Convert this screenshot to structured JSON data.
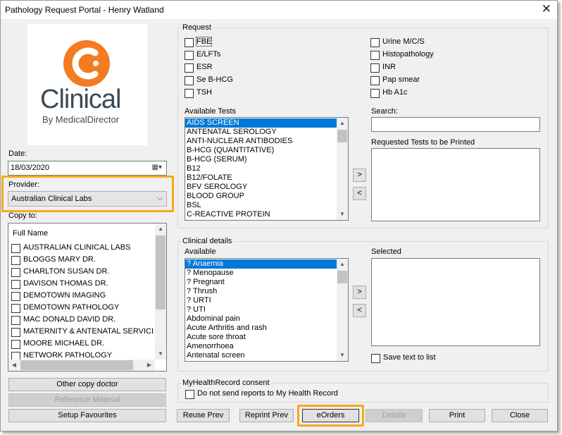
{
  "window": {
    "title": "Pathology Request Portal - Henry Watland"
  },
  "logo": {
    "brand": "Clinical",
    "tagline": "By MedicalDirector",
    "accent": "#f47b20"
  },
  "date": {
    "label": "Date:",
    "value": "18/03/2020"
  },
  "provider": {
    "label": "Provider:",
    "value": "Australian Clinical Labs"
  },
  "copy_to": {
    "label": "Copy to:",
    "header": "Full Name",
    "items": [
      "AUSTRALIAN CLINICAL LABS",
      "BLOGGS MARY DR.",
      "CHARLTON SUSAN DR.",
      "DAVISON THOMAS DR.",
      "DEMOTOWN IMAGING",
      "DEMOTOWN PATHOLOGY",
      "MAC DONALD DAVID DR.",
      "MATERNITY & ANTENATAL SERVICI",
      "MOORE MICHAEL DR.",
      "NETWORK PATHOLOGY"
    ]
  },
  "left_buttons": {
    "other_copy_doctor": "Other copy doctor",
    "reference_material": "Reference Material",
    "setup_favourites": "Setup Favourites"
  },
  "request": {
    "title": "Request",
    "left": [
      "FBE",
      "E/LFTs",
      "ESR",
      "Se B-HCG",
      "TSH"
    ],
    "right": [
      "Urine M/C/S",
      "Histopathology",
      "INR",
      "Pap smear",
      "Hb A1c"
    ]
  },
  "available_tests": {
    "label": "Available Tests",
    "items": [
      "AIDS SCREEN",
      "ANTENATAL SEROLOGY",
      "ANTI-NUCLEAR ANTIBODIES",
      "B-HCG (QUANTITATIVE)",
      "B-HCG (SERUM)",
      "B12",
      "B12/FOLATE",
      "BFV SEROLOGY",
      "BLOOD GROUP",
      "BSL",
      "C-REACTIVE PROTEIN"
    ]
  },
  "search": {
    "label": "Search:",
    "value": ""
  },
  "requested_tests": {
    "label": "Requested Tests to be Printed"
  },
  "move": {
    "right": ">",
    "left": "<"
  },
  "clinical": {
    "title": "Clinical details",
    "available_label": "Available",
    "selected_label": "Selected",
    "items": [
      "? Anaemia",
      "? Menopause",
      "? Pregnant",
      "? Thrush",
      "? URTI",
      "? UTI",
      "Abdominal pain",
      "Acute Arthritis and rash",
      "Acute sore throat",
      "Amenorrhoea",
      "Antenatal screen"
    ],
    "save_text": "Save text to list"
  },
  "mhr": {
    "title": "MyHealthRecord consent",
    "checkbox": "Do not send reports to My Health Record"
  },
  "bottom_buttons": {
    "reuse_prev": "Reuse Prev",
    "reprint_prev": "Reprint Prev",
    "eorders": "eOrders",
    "details": "Details",
    "print": "Print",
    "close": "Close"
  },
  "colors": {
    "highlight": "#f7a81b",
    "selection": "#0078d7"
  }
}
